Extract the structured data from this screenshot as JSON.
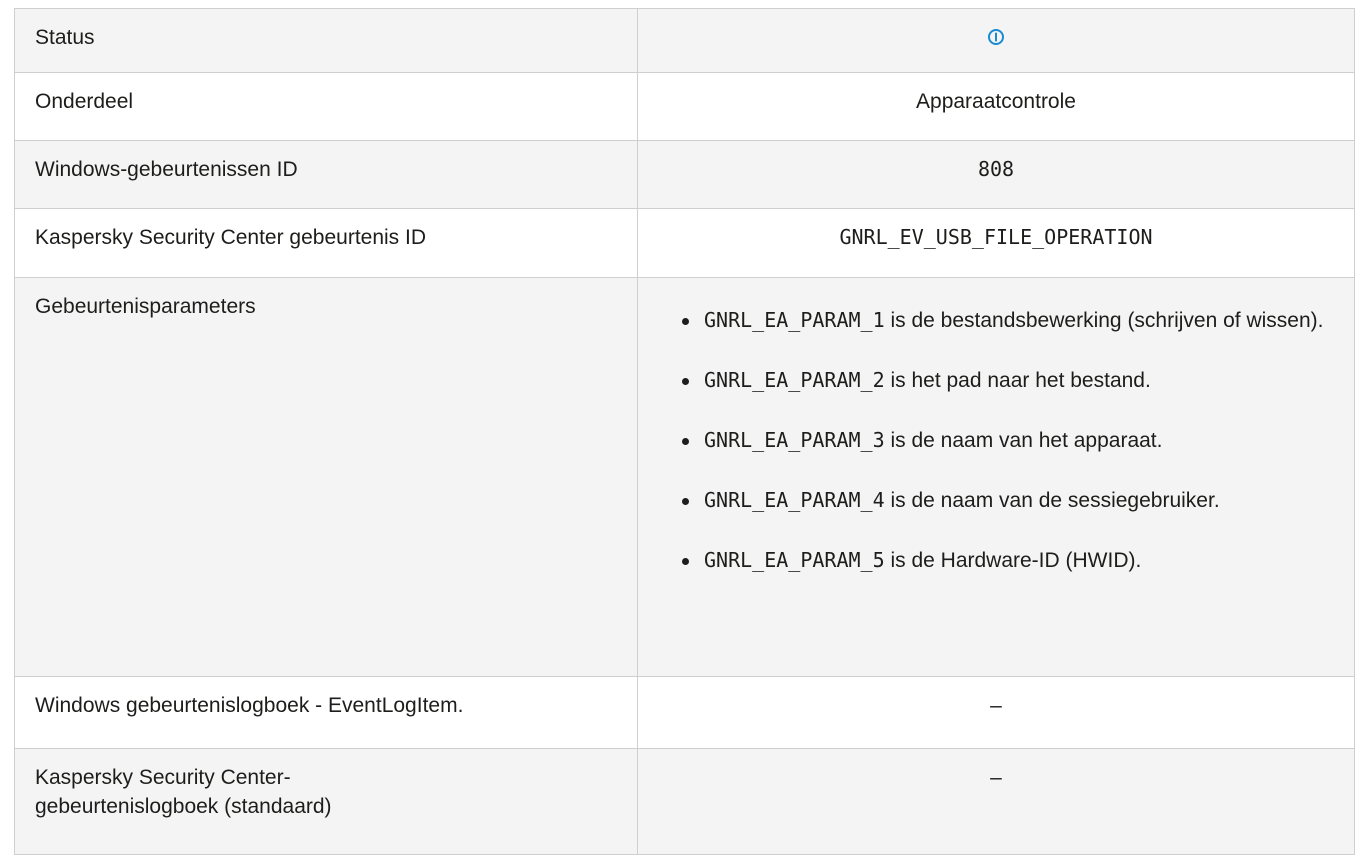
{
  "rows": {
    "status": {
      "label": "Status",
      "icon": "info-circle-icon",
      "icon_color": "#1a8ad1"
    },
    "onderdeel": {
      "label": "Onderdeel",
      "value": "Apparaatcontrole"
    },
    "windows_event_id": {
      "label": "Windows-gebeurtenissen ID",
      "value": "808"
    },
    "ksc_event_id": {
      "label": "Kaspersky Security Center gebeurtenis ID",
      "value": "GNRL_EV_USB_FILE_OPERATION"
    },
    "parameters": {
      "label": "Gebeurtenisparameters",
      "items": [
        {
          "code": "GNRL_EA_PARAM_1",
          "text": " is de bestandsbewerking (schrijven of wissen)."
        },
        {
          "code": "GNRL_EA_PARAM_2",
          "text": " is het pad naar het bestand."
        },
        {
          "code": "GNRL_EA_PARAM_3",
          "text": " is de naam van het apparaat."
        },
        {
          "code": "GNRL_EA_PARAM_4",
          "text": " is de naam van de sessiegebruiker."
        },
        {
          "code": "GNRL_EA_PARAM_5",
          "text": " is de Hardware-ID (HWID)."
        }
      ]
    },
    "windows_event_log": {
      "label": "Windows gebeurtenislogboek - EventLogItem.",
      "value": "–"
    },
    "ksc_event_log": {
      "label": "Kaspersky Security Center-gebeurtenislogboek (standaard)",
      "value": "–"
    }
  }
}
